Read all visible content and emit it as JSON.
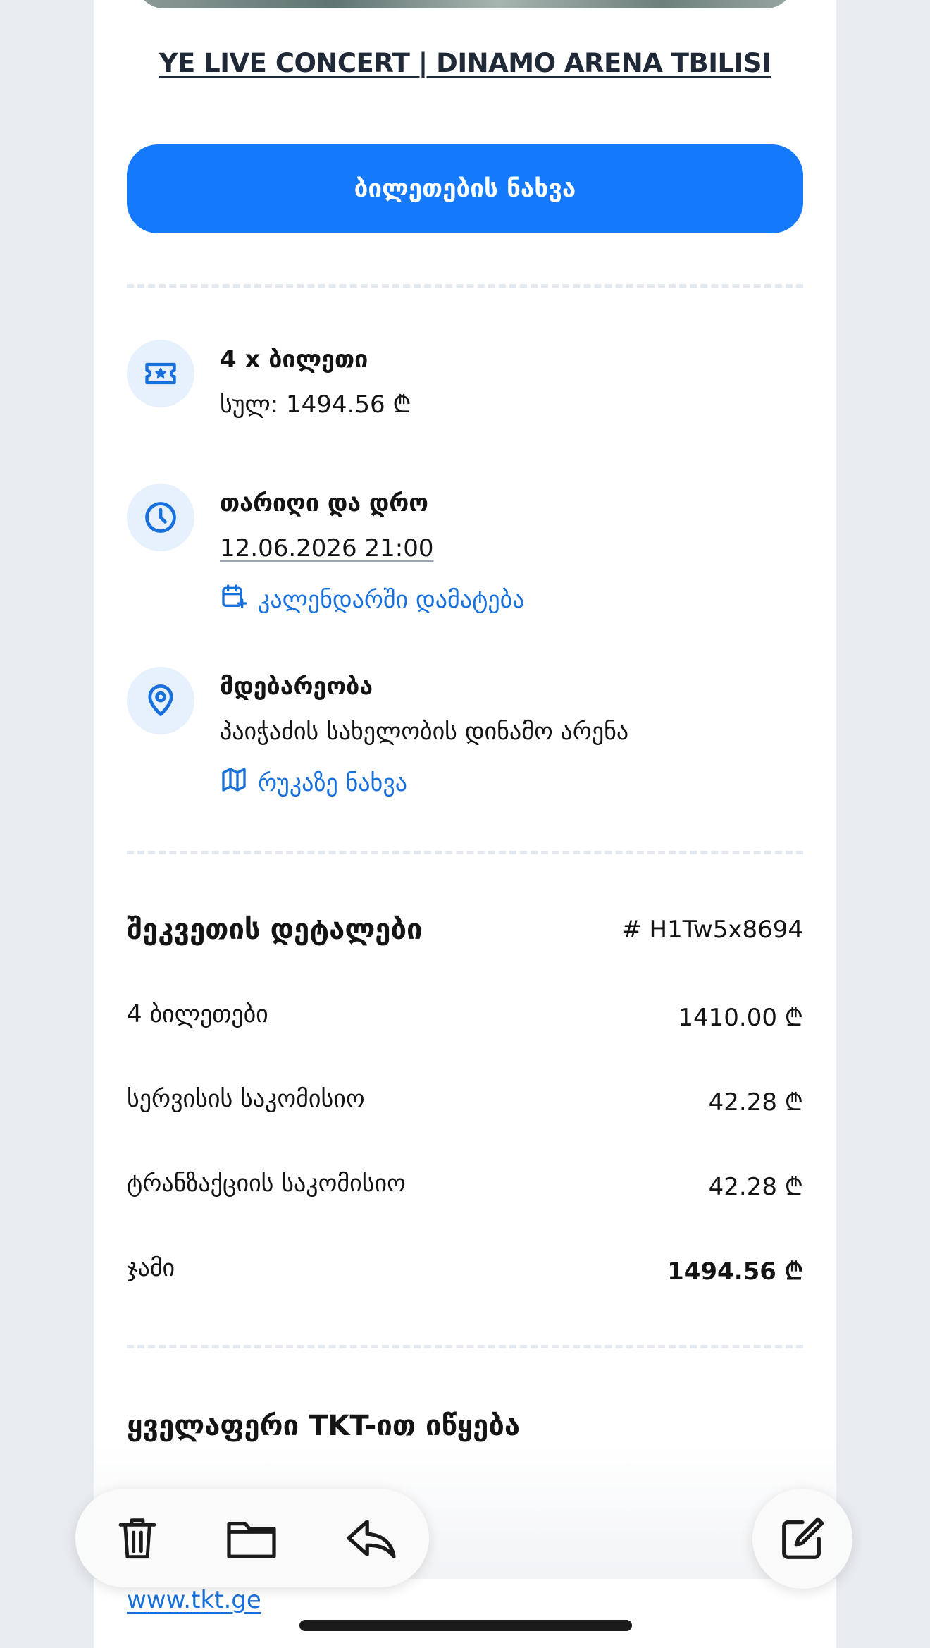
{
  "event": {
    "title": "YE LIVE CONCERT | DINAMO ARENA TBILISI",
    "view_tickets_label": "ბილეთების ნახვა"
  },
  "tickets": {
    "label": "4 x ბილეთი",
    "total": "სულ: 1494.56 ₾",
    "icon": "ticket-icon"
  },
  "datetime": {
    "label": "თარიღი და დრო",
    "value": "12.06.2026 21:00",
    "add_calendar_label": "კალენდარში დამატება",
    "icon": "clock-icon"
  },
  "location": {
    "label": "მდებარეობა",
    "value": "პაიჭაძის სახელობის დინამო არენა",
    "map_label": "რუკაზე ნახვა",
    "icon": "map-pin-icon"
  },
  "order": {
    "title": "შეკვეთის დეტალები",
    "id": "# H1Tw5x8694",
    "rows": [
      {
        "label": "4 ბილეთები",
        "value": "1410.00 ₾"
      },
      {
        "label": "სერვისის საკომისიო",
        "value": "42.28 ₾"
      },
      {
        "label": "ტრანზაქციის საკომისიო",
        "value": "42.28 ₾"
      },
      {
        "label": "ჯამი",
        "value": "1494.56 ₾"
      }
    ]
  },
  "footer": {
    "tagline": "ყველაფერი TKT-ით იწყება",
    "website": "www.tkt.ge"
  },
  "colors": {
    "accent": "#1479fb",
    "link": "#1870dc",
    "icon_bg": "#e7f1fe"
  }
}
